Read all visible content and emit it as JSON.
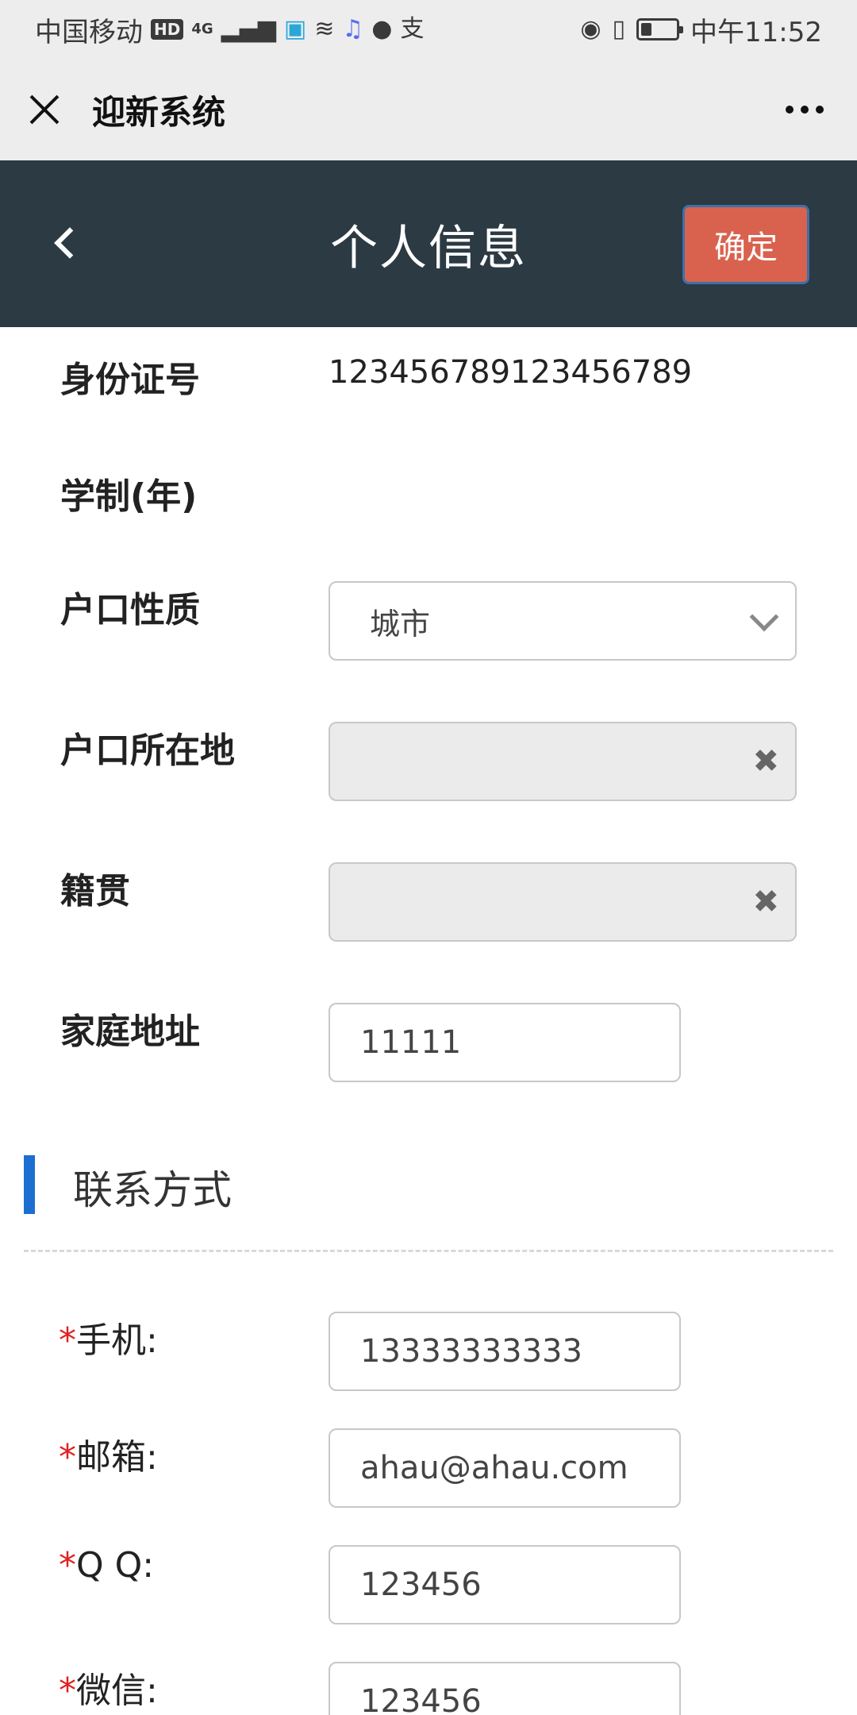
{
  "status_bar": {
    "carrier": "中国移动",
    "hd": "HD",
    "net": "4G",
    "time": "中午11:52"
  },
  "wechat_bar": {
    "title": "迎新系统"
  },
  "header": {
    "title": "个人信息",
    "confirm_label": "确定"
  },
  "fields": {
    "id_number": {
      "label": "身份证号",
      "value": "123456789123456789"
    },
    "schooling": {
      "label": "学制(年)"
    },
    "hukou_type": {
      "label": "户口性质",
      "value": "城市"
    },
    "hukou_location": {
      "label": "户口所在地"
    },
    "native_place": {
      "label": "籍贯"
    },
    "home_address": {
      "label": "家庭地址",
      "value": "11111"
    }
  },
  "contact": {
    "section_title": "联系方式",
    "required_mark": "*",
    "phone": {
      "label": "手机:",
      "value": "13333333333"
    },
    "email": {
      "label": "邮箱:",
      "value": "ahau@ahau.com"
    },
    "qq": {
      "label": "Q Q:",
      "value": "123456"
    },
    "wechat": {
      "label": "微信:",
      "value": "123456"
    }
  },
  "icons": {
    "clear": "✖",
    "chevron": "chevron-down-icon"
  },
  "colors": {
    "header_bg": "#2b3a43",
    "confirm_bg": "#d9624f",
    "section_accent": "#1c6fd1",
    "required": "#e02020"
  },
  "battery_level": 0.3
}
